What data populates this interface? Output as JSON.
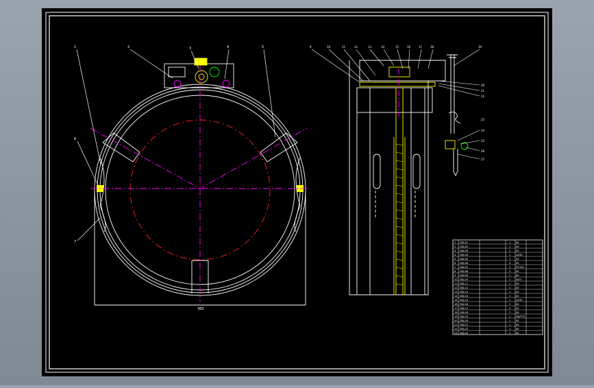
{
  "drawing": {
    "background": "#000000",
    "line_color": "#ffffff",
    "center_line_color": "#ff00ff",
    "pitch_circle_color": "#ff0000",
    "part_color": "#ffff00",
    "tool_color": "#00ff00"
  },
  "front_view": {
    "balloon_labels": [
      "1",
      "2",
      "3",
      "4",
      "5",
      "6",
      "7",
      "8"
    ],
    "width_dimension": "380"
  },
  "side_view": {
    "balloon_labels_top": [
      "9",
      "10",
      "11",
      "12",
      "13",
      "14",
      "15",
      "16",
      "17",
      "18",
      "19",
      "20",
      "21",
      "22"
    ],
    "balloon_labels_right": [
      "23",
      "24",
      "25",
      "26",
      "27",
      "28",
      "29",
      "30"
    ]
  },
  "parts_list": {
    "rows": [
      {
        "no": "1",
        "name": "DDJ-01",
        "qty": "1",
        "material": "45"
      },
      {
        "no": "2",
        "name": "DDJ-02",
        "qty": "1",
        "material": "45"
      },
      {
        "no": "3",
        "name": "DDJ-03",
        "qty": "2",
        "material": "45"
      },
      {
        "no": "4",
        "name": "DDJ-04",
        "qty": "1",
        "material": "Q235"
      },
      {
        "no": "5",
        "name": "DDJ-05",
        "qty": "1",
        "material": "45"
      },
      {
        "no": "6",
        "name": "DDJ-06",
        "qty": "4",
        "material": "45"
      },
      {
        "no": "7",
        "name": "DDJ-07",
        "qty": "1",
        "material": "HT200"
      },
      {
        "no": "8",
        "name": "DDJ-08",
        "qty": "2",
        "material": "45"
      },
      {
        "no": "9",
        "name": "DDJ-09",
        "qty": "1",
        "material": "45"
      },
      {
        "no": "10",
        "name": "DDJ-10",
        "qty": "1",
        "material": "40Cr"
      },
      {
        "no": "11",
        "name": "DDJ-11",
        "qty": "1",
        "material": "45"
      },
      {
        "no": "12",
        "name": "DDJ-12",
        "qty": "2",
        "material": "45"
      },
      {
        "no": "13",
        "name": "DDJ-13",
        "qty": "1",
        "material": "45"
      },
      {
        "no": "14",
        "name": "DDJ-14",
        "qty": "1",
        "material": "45"
      },
      {
        "no": "15",
        "name": "DDJ-15",
        "qty": "1",
        "material": "Q235"
      },
      {
        "no": "16",
        "name": "DDJ-16",
        "qty": "1",
        "material": "45"
      },
      {
        "no": "17",
        "name": "DDJ-17",
        "qty": "2",
        "material": "45"
      },
      {
        "no": "18",
        "name": "DDJ-18",
        "qty": "1",
        "material": "45"
      },
      {
        "no": "19",
        "name": "DDJ-19",
        "qty": "1",
        "material": "GB/T70"
      },
      {
        "no": "20",
        "name": "DDJ-20",
        "qty": "1",
        "material": "45"
      },
      {
        "no": "21",
        "name": "DDJ-21",
        "qty": "1",
        "material": "45"
      },
      {
        "no": "22",
        "name": "DDJ-22",
        "qty": "1",
        "material": "45"
      },
      {
        "no": "23",
        "name": "DDJ-23",
        "qty": "1",
        "material": "45"
      }
    ]
  }
}
